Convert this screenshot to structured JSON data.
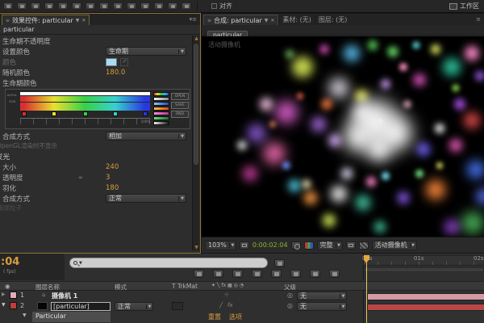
{
  "toolbar": {
    "tools": [
      "selection",
      "hand",
      "zoom",
      "rotation",
      "unified-camera",
      "pan-behind",
      "mask-shape",
      "pen",
      "type",
      "brush",
      "clone-stamp",
      "eraser",
      "roto-brush",
      "puppet-pin"
    ],
    "snap_label": "对齐",
    "workspace_label": "工作区"
  },
  "effect_panel": {
    "tab_title": "效果控件: particular",
    "layer_name": "particular",
    "rows": {
      "opacity_over_life": "生命期不透明度",
      "set_color": "设置颜色",
      "set_color_value": "生命期",
      "color": "颜色",
      "color_swatch": "#a8dcf4",
      "color_random": "随机颜色",
      "color_random_value": "180.0",
      "color_over_life": "生命期颜色",
      "transfer_mode": "合成方式",
      "transfer_mode_value": "相加",
      "note": "OpenGL渲染时不显示",
      "glow_header": "发光",
      "glow_size": "大小",
      "glow_size_value": "240",
      "glow_opacity": "透明度",
      "glow_opacity_value": "3",
      "glow_feather": "羽化",
      "glow_feather_value": "180",
      "glow_transfer": "合成方式",
      "glow_transfer_value": "正常",
      "footer_note": "拖尾粒子"
    },
    "gradient": {
      "alpha_label": "ALPHA",
      "rgb_label": "RGB",
      "scale_label": "100%",
      "stops": [
        {
          "pos": 3,
          "color": "#d83030"
        },
        {
          "pos": 26,
          "color": "#e8e030"
        },
        {
          "pos": 50,
          "color": "#38d048"
        },
        {
          "pos": 73,
          "color": "#38d0d0"
        },
        {
          "pos": 96,
          "color": "#2838e0"
        }
      ],
      "presets": [
        [
          "#e03030",
          "#e8e030",
          "#30c040",
          "#30b8e8",
          "#3040e0"
        ],
        [
          "#f8f8f8",
          "#8a8a8a"
        ],
        [
          "#90c8f8",
          "#2048c0"
        ],
        [
          "#f8c040",
          "#e04818"
        ],
        [
          "#f890d8",
          "#c03090"
        ],
        [
          "#70e070",
          "#187838"
        ],
        [
          "#f0f0f0",
          "#181818"
        ]
      ],
      "buttons": [
        "OPEN",
        "SAVE",
        "RND"
      ]
    }
  },
  "viewer": {
    "tab_comp": "合成: particular",
    "tab_footage": "素材: (无)",
    "tab_layer": "图层: (无)",
    "subtab": "particular",
    "overlay_camera": "活动摄像机",
    "emitter_color": "#7a2424",
    "toolbar": {
      "zoom": "103%",
      "timecode": "0:00:02:04",
      "resolution": "完整",
      "view": "活动摄像机"
    },
    "particles": [
      [
        35.7,
        15.5,
        26,
        "#ccdc50",
        6
      ],
      [
        31,
        9,
        10,
        "#7ac860",
        4
      ],
      [
        43.4,
        6.5,
        11,
        "#e050c0",
        4
      ],
      [
        53,
        8.6,
        20,
        "#58c0f0",
        6
      ],
      [
        60.6,
        4.5,
        12,
        "#58d058",
        4
      ],
      [
        67.7,
        7.8,
        13,
        "#68e068",
        4
      ],
      [
        76,
        4.5,
        9,
        "#58d8d8",
        3
      ],
      [
        82.9,
        6.5,
        12,
        "#e0e860",
        4
      ],
      [
        95.7,
        8.6,
        18,
        "#ff88c8",
        5
      ],
      [
        88.6,
        15.5,
        22,
        "#2cc49c",
        6
      ],
      [
        71.4,
        15.5,
        10,
        "#ff90c0",
        3
      ],
      [
        65.1,
        23.7,
        12,
        "#c090e8",
        4
      ],
      [
        56.6,
        29.8,
        16,
        "#e8e850",
        5
      ],
      [
        77,
        21.6,
        15,
        "#e858c8",
        5
      ],
      [
        90,
        25.7,
        9,
        "#88d048",
        3
      ],
      [
        98.6,
        19.6,
        12,
        "#9858e0",
        4
      ],
      [
        91.4,
        33.9,
        14,
        "#a048d8",
        4
      ],
      [
        95.7,
        42,
        20,
        "#e04848",
        6
      ],
      [
        84.3,
        46.1,
        12,
        "#ececec",
        4
      ],
      [
        72.9,
        33.9,
        10,
        "#c08898",
        3
      ],
      [
        48.6,
        25.7,
        24,
        "#f2eef8",
        8
      ],
      [
        44.3,
        33.9,
        14,
        "#d86830",
        4
      ],
      [
        34.9,
        29.8,
        8,
        "#e06040",
        3
      ],
      [
        22.9,
        33.9,
        16,
        "#f0c0e0",
        5
      ],
      [
        30,
        38,
        28,
        "#e060d0",
        8
      ],
      [
        19.4,
        48.2,
        22,
        "#9060e0",
        7
      ],
      [
        25.1,
        44.1,
        8,
        "#c87038",
        3
      ],
      [
        14.3,
        54.3,
        12,
        "#cfcfcf",
        4
      ],
      [
        25.7,
        58.4,
        26,
        "#ff70b8",
        8
      ],
      [
        17.1,
        68.6,
        18,
        "#d040a0",
        6
      ],
      [
        30,
        64.5,
        10,
        "#5080e8",
        3
      ],
      [
        32.9,
        74.7,
        15,
        "#50d0e8",
        5
      ],
      [
        37.1,
        73.9,
        11,
        "#f0e0b0",
        4
      ],
      [
        38.6,
        80.8,
        17,
        "#e89040",
        5
      ],
      [
        41.4,
        44.1,
        18,
        "#b070e8",
        6
      ],
      [
        47.1,
        52.2,
        16,
        "#c8a0f0",
        5
      ],
      [
        61.7,
        42.4,
        52,
        "#ffffff",
        12
      ],
      [
        55.7,
        50.2,
        38,
        "#ffffff",
        11
      ],
      [
        68.6,
        48.2,
        42,
        "#ffffff",
        11
      ],
      [
        62.9,
        56.3,
        30,
        "#ffffff",
        9
      ],
      [
        57,
        38,
        24,
        "#fff8ff",
        8
      ],
      [
        51.4,
        68.6,
        14,
        "#e8e8ff",
        5
      ],
      [
        48.6,
        78.8,
        20,
        "#f0f0f0",
        6
      ],
      [
        57.1,
        82.9,
        18,
        "#48d8b0",
        6
      ],
      [
        60,
        72.7,
        12,
        "#ff88d0",
        4
      ],
      [
        65.1,
        69.8,
        10,
        "#70e0f0",
        3
      ],
      [
        71.4,
        80.8,
        15,
        "#8858e8",
        5
      ],
      [
        77.1,
        68.6,
        10,
        "#70e080",
        3
      ],
      [
        78.6,
        56.3,
        17,
        "#6858e8",
        5
      ],
      [
        84.3,
        64.5,
        8,
        "#e8e060",
        3
      ],
      [
        90,
        54.3,
        16,
        "#e858b8",
        5
      ],
      [
        97.1,
        66.5,
        22,
        "#4878ff",
        7
      ],
      [
        82.9,
        76.7,
        24,
        "#ff8838",
        7
      ],
      [
        96,
        93,
        26,
        "#50c060",
        8
      ],
      [
        100,
        80,
        20,
        "#5068e0",
        6
      ],
      [
        88.6,
        95,
        18,
        "#9040d0",
        6
      ],
      [
        45,
        92,
        16,
        "#d0e858",
        5
      ],
      [
        63,
        95,
        14,
        "#40c8a0",
        5
      ],
      [
        63.4,
        42.4,
        6,
        "#7a2424",
        0
      ]
    ]
  },
  "timeline": {
    "timecode_partial": ":04",
    "fps_partial": "( fps)",
    "ruler_labels": [
      "00s",
      "01s",
      "02s"
    ],
    "mini_tools": [
      "comp-mini-flowchart",
      "draft-3d",
      "hide-shy",
      "frame-blend",
      "motion-blur",
      "brainstorm",
      "auto-keyframe",
      "graph-editor"
    ],
    "columns": {
      "layer_name": "图层名称",
      "mode": "模式",
      "trkmat": "T TrkMat",
      "switches": "✦ ╲ fx ▦ ◎ ◔",
      "parent": "父级"
    },
    "layers": [
      {
        "index": "1",
        "label_color": "#e8aab4",
        "name": "摄像机 1",
        "parent": "无",
        "bar_color": "#d49aa4"
      },
      {
        "index": "2",
        "label_color": "#c23c3c",
        "name": "[particular]",
        "mode": "正常",
        "parent": "无",
        "bar_color": "#b84848"
      }
    ],
    "effect_row": {
      "name": "Particular",
      "reset": "重置",
      "options": "选项"
    }
  }
}
